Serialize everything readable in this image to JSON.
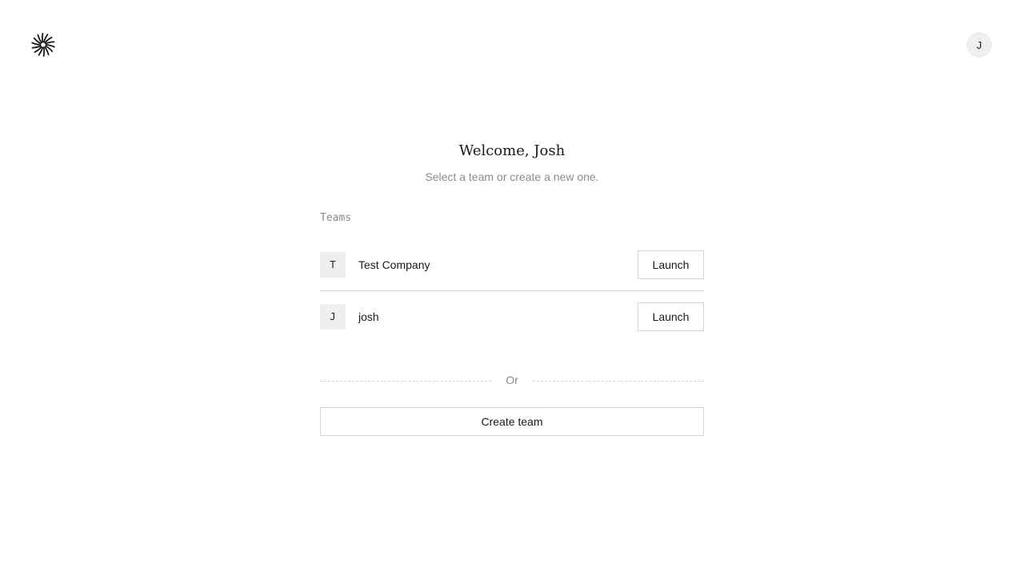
{
  "header": {
    "logo_icon": "asterisk-burst-icon",
    "avatar_initial": "J"
  },
  "main": {
    "title": "Welcome, Josh",
    "subtitle": "Select a team or create a new one.",
    "teams_label": "Teams",
    "teams": [
      {
        "initial": "T",
        "name": "Test Company",
        "action_label": "Launch"
      },
      {
        "initial": "J",
        "name": "josh",
        "action_label": "Launch"
      }
    ],
    "or_label": "Or",
    "create_label": "Create team"
  },
  "colors": {
    "text": "#1a1a1a",
    "muted": "#8a8a8a",
    "chip_bg": "#f0efed",
    "border": "#d4d4d4"
  }
}
